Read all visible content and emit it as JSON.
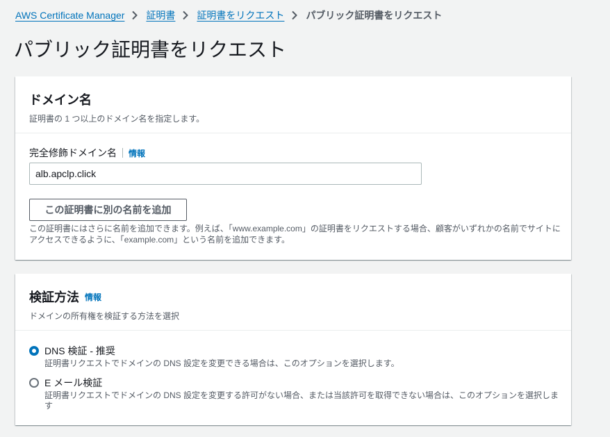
{
  "breadcrumb": {
    "items": [
      "AWS Certificate Manager",
      "証明書",
      "証明書をリクエスト"
    ],
    "current": "パブリック証明書をリクエスト"
  },
  "page_title": "パブリック証明書をリクエスト",
  "domain_panel": {
    "title": "ドメイン名",
    "description": "証明書の 1 つ以上のドメイン名を指定します。",
    "fqdn_label": "完全修飾ドメイン名",
    "info_label": "情報",
    "fqdn_value": "alb.apclp.click",
    "add_name_button": "この証明書に別の名前を追加",
    "help_text": "この証明書にはさらに名前を追加できます。例えば、「www.example.com」の証明書をリクエストする場合、顧客がいずれかの名前でサイトにアクセスできるように、「example.com」という名前を追加できます。"
  },
  "validation_panel": {
    "title": "検証方法",
    "info_label": "情報",
    "description": "ドメインの所有権を検証する方法を選択",
    "options": [
      {
        "label": "DNS 検証 - 推奨",
        "description": "証明書リクエストでドメインの DNS 設定を変更できる場合は、このオプションを選択します。",
        "selected": true
      },
      {
        "label": "E メール検証",
        "description": "証明書リクエストでドメインの DNS 設定を変更する許可がない場合、または当該許可を取得できない場合は、このオプションを選択します",
        "selected": false
      }
    ]
  },
  "colors": {
    "link": "#0073bb",
    "background": "#f2f3f3",
    "text_secondary": "#545b64"
  }
}
